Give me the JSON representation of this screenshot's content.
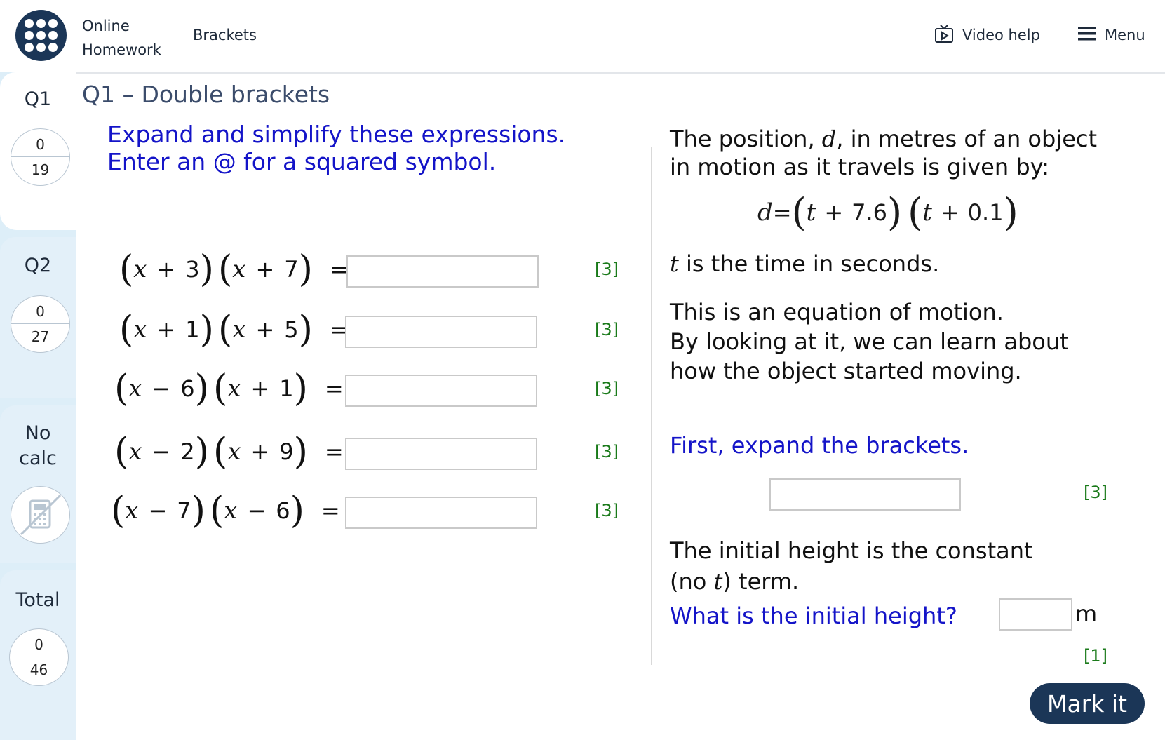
{
  "header": {
    "brand_line1": "Online",
    "brand_line2": "Homework",
    "breadcrumb": "Brackets",
    "video_help": "Video help",
    "menu": "Menu"
  },
  "sidebar": {
    "q1": {
      "label": "Q1",
      "score": "0",
      "max": "19"
    },
    "q2": {
      "label": "Q2",
      "score": "0",
      "max": "27"
    },
    "nocalc": {
      "line1": "No",
      "line2": "calc"
    },
    "total": {
      "label": "Total",
      "score": "0",
      "max": "46"
    }
  },
  "question": {
    "title": "Q1 – Double brackets",
    "instruction1": "Expand and simplify these expressions.",
    "instruction2": "Enter an @ for a squared symbol."
  },
  "expressions": [
    {
      "a_sign": "+",
      "a": "3",
      "b_sign": "+",
      "b": "7",
      "marks": "[3]"
    },
    {
      "a_sign": "+",
      "a": "1",
      "b_sign": "+",
      "b": "5",
      "marks": "[3]"
    },
    {
      "a_sign": "−",
      "a": "6",
      "b_sign": "+",
      "b": "1",
      "marks": "[3]"
    },
    {
      "a_sign": "−",
      "a": "2",
      "b_sign": "+",
      "b": "9",
      "marks": "[3]"
    },
    {
      "a_sign": "−",
      "a": "7",
      "b_sign": "−",
      "b": "6",
      "marks": "[3]"
    }
  ],
  "variable": "x",
  "equals": "=",
  "right": {
    "intro1a": "The position, ",
    "intro_var": "d",
    "intro1b": ", in metres of an object",
    "intro2": "in motion as it travels is given by:",
    "formula": {
      "lhs": "d",
      "eq": "=",
      "var": "t",
      "plus": "+",
      "c1": "7.6",
      "c2": "0.1"
    },
    "time_var": "t",
    "time_text": " is the time in seconds.",
    "motion1": "This is an equation of motion.",
    "motion2": "By looking at it, we can learn about",
    "motion3": "how the object started moving.",
    "expand_prompt": "First, expand the brackets.",
    "expand_marks": "[3]",
    "height1": "The initial height is the constant",
    "height2a": "(no ",
    "height2_var": "t",
    "height2b": ") term.",
    "height_question": "What is the initial height?",
    "height_unit": "m",
    "height_marks": "[1]"
  },
  "mark_button": "Mark it"
}
